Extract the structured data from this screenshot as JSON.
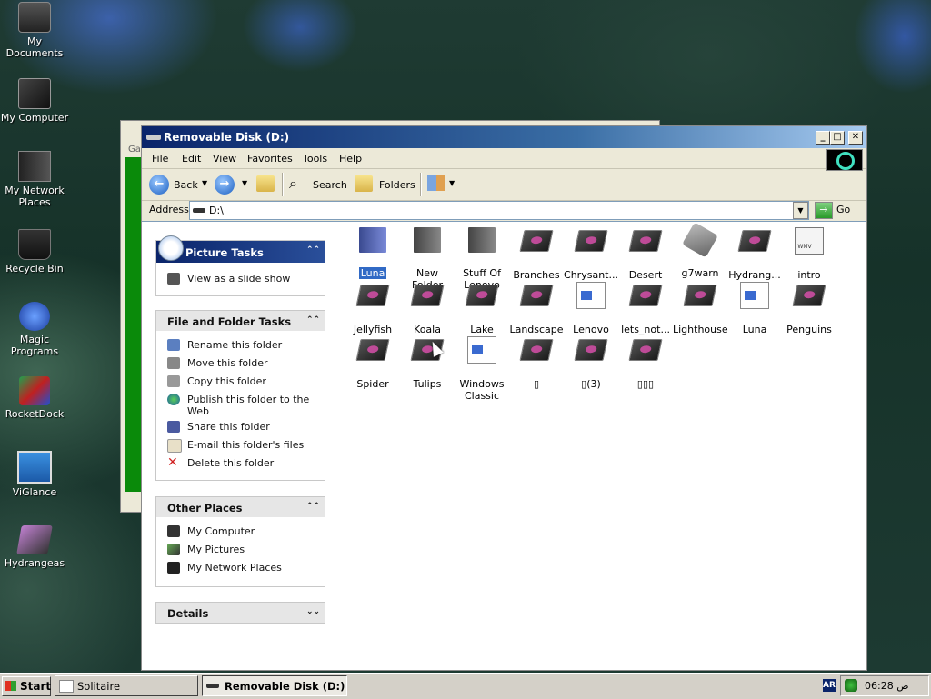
{
  "desktop": {
    "icons": [
      {
        "label": "My Documents",
        "icon": "drive-icon"
      },
      {
        "label": "My Computer",
        "icon": "computer-icon"
      },
      {
        "label": "My Network Places",
        "icon": "network-icon"
      },
      {
        "label": "Recycle Bin",
        "icon": "recycle-bin-icon"
      },
      {
        "label": "Magic Programs",
        "icon": "magic-icon"
      },
      {
        "label": "RocketDock",
        "icon": "rocketdock-icon"
      },
      {
        "label": "ViGlance",
        "icon": "viglance-icon"
      },
      {
        "label": "Hydrangeas",
        "icon": "image-icon"
      }
    ]
  },
  "background_window": {
    "label": "Ga"
  },
  "window": {
    "title": "Removable Disk (D:)",
    "menu": [
      "File",
      "Edit",
      "View",
      "Favorites",
      "Tools",
      "Help"
    ],
    "toolbar": {
      "back": "Back",
      "search": "Search",
      "folders": "Folders"
    },
    "address": {
      "label": "Address",
      "value": "D:\\",
      "go": "Go"
    },
    "panels": {
      "picture_tasks": {
        "title": "Picture Tasks",
        "items": [
          "View as a slide show"
        ]
      },
      "file_folder_tasks": {
        "title": "File and Folder Tasks",
        "items": [
          "Rename this folder",
          "Move this folder",
          "Copy this folder",
          "Publish this folder to the Web",
          "Share this folder",
          "E-mail this folder's files",
          "Delete this folder"
        ]
      },
      "other_places": {
        "title": "Other Places",
        "items": [
          "My Computer",
          "My Pictures",
          "My Network Places"
        ]
      },
      "details": {
        "title": "Details"
      }
    },
    "files": [
      {
        "name": "Luna",
        "type": "folder-blue",
        "selected": true
      },
      {
        "name": "New Folder",
        "type": "folder"
      },
      {
        "name": "Stuff Of Lenovo",
        "type": "folder"
      },
      {
        "name": "Branches",
        "type": "image"
      },
      {
        "name": "Chrysant...",
        "type": "image"
      },
      {
        "name": "Desert",
        "type": "image"
      },
      {
        "name": "g7warn",
        "type": "tool"
      },
      {
        "name": "Hydrang...",
        "type": "image"
      },
      {
        "name": "intro",
        "type": "wmv"
      },
      {
        "name": "Jellyfish",
        "type": "image"
      },
      {
        "name": "Koala",
        "type": "image"
      },
      {
        "name": "Lake",
        "type": "image"
      },
      {
        "name": "Landscape",
        "type": "image"
      },
      {
        "name": "Lenovo",
        "type": "doc"
      },
      {
        "name": "lets_not...",
        "type": "image"
      },
      {
        "name": "Lighthouse",
        "type": "image"
      },
      {
        "name": "Luna",
        "type": "doc"
      },
      {
        "name": "Penguins",
        "type": "image"
      },
      {
        "name": "Spider",
        "type": "image"
      },
      {
        "name": "Tulips",
        "type": "image"
      },
      {
        "name": "Windows Classic",
        "type": "doc"
      },
      {
        "name": "▯",
        "type": "image"
      },
      {
        "name": "▯(3)",
        "type": "image"
      },
      {
        "name": "▯▯▯",
        "type": "image"
      }
    ]
  },
  "taskbar": {
    "start": "Start",
    "tasks": [
      {
        "label": "Solitaire",
        "active": false
      },
      {
        "label": "Removable Disk (D:)",
        "active": true
      }
    ],
    "language": "AR",
    "clock": "06:28 ص"
  }
}
